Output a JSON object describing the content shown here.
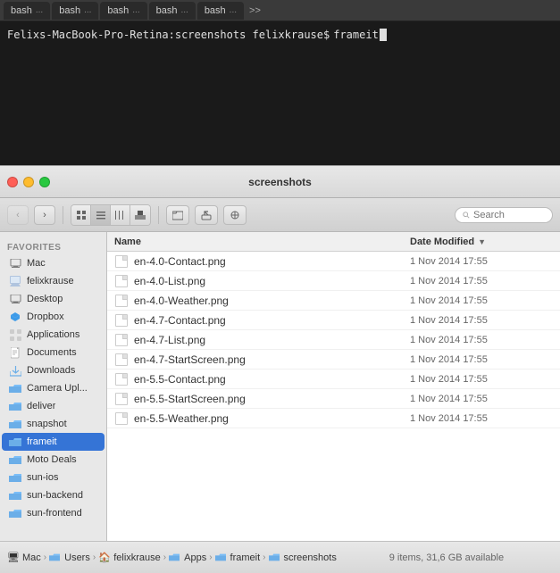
{
  "terminal": {
    "tabs": [
      {
        "label": "bash",
        "dots": "..."
      },
      {
        "label": "bash",
        "dots": "..."
      },
      {
        "label": "bash",
        "dots": "..."
      },
      {
        "label": "bash",
        "dots": "..."
      },
      {
        "label": "bash",
        "dots": "..."
      },
      {
        "label": "bash ...",
        "dots": ">>"
      }
    ],
    "prompt": "Felixs-MacBook-Pro-Retina:screenshots felixkrause$",
    "command": "frameit"
  },
  "finder": {
    "title": "screenshots",
    "toolbar": {
      "search_placeholder": "Search"
    },
    "sidebar": {
      "section_label": "Favorites",
      "items": [
        {
          "id": "mac",
          "label": "Mac",
          "icon": "🖥"
        },
        {
          "id": "felixkrause",
          "label": "felixkrause",
          "icon": "🏠"
        },
        {
          "id": "desktop",
          "label": "Desktop",
          "icon": "🖥"
        },
        {
          "id": "dropbox",
          "label": "Dropbox",
          "icon": "📦"
        },
        {
          "id": "applications",
          "label": "Applications",
          "icon": "📱"
        },
        {
          "id": "documents",
          "label": "Documents",
          "icon": "📄"
        },
        {
          "id": "downloads",
          "label": "Downloads",
          "icon": "📥"
        },
        {
          "id": "camera-upl",
          "label": "Camera Upl...",
          "icon": "📁"
        },
        {
          "id": "deliver",
          "label": "deliver",
          "icon": "📁"
        },
        {
          "id": "snapshot",
          "label": "snapshot",
          "icon": "📁"
        },
        {
          "id": "frameit",
          "label": "frameit",
          "icon": "📁"
        },
        {
          "id": "moto-deals",
          "label": "Moto Deals",
          "icon": "📁"
        },
        {
          "id": "sun-ios",
          "label": "sun-ios",
          "icon": "📁"
        },
        {
          "id": "sun-backend",
          "label": "sun-backend",
          "icon": "📁"
        },
        {
          "id": "sun-frontend",
          "label": "sun-frontend",
          "icon": "📁"
        }
      ]
    },
    "file_list": {
      "col_name": "Name",
      "col_date": "Date Modified",
      "files": [
        {
          "name": "en-4.0-Contact.png",
          "date": "1 Nov 2014 17:55"
        },
        {
          "name": "en-4.0-List.png",
          "date": "1 Nov 2014 17:55"
        },
        {
          "name": "en-4.0-Weather.png",
          "date": "1 Nov 2014 17:55"
        },
        {
          "name": "en-4.7-Contact.png",
          "date": "1 Nov 2014 17:55"
        },
        {
          "name": "en-4.7-List.png",
          "date": "1 Nov 2014 17:55"
        },
        {
          "name": "en-4.7-StartScreen.png",
          "date": "1 Nov 2014 17:55"
        },
        {
          "name": "en-5.5-Contact.png",
          "date": "1 Nov 2014 17:55"
        },
        {
          "name": "en-5.5-StartScreen.png",
          "date": "1 Nov 2014 17:55"
        },
        {
          "name": "en-5.5-Weather.png",
          "date": "1 Nov 2014 17:55"
        }
      ]
    },
    "statusbar": {
      "count": "9 items, 31,6 GB available",
      "path": [
        {
          "label": "Mac",
          "type": "mac"
        },
        {
          "label": "Users",
          "type": "folder"
        },
        {
          "label": "felixkrause",
          "type": "user"
        },
        {
          "label": "Apps",
          "type": "folder"
        },
        {
          "label": "frameit",
          "type": "folder"
        },
        {
          "label": "screenshots",
          "type": "folder"
        }
      ]
    }
  }
}
